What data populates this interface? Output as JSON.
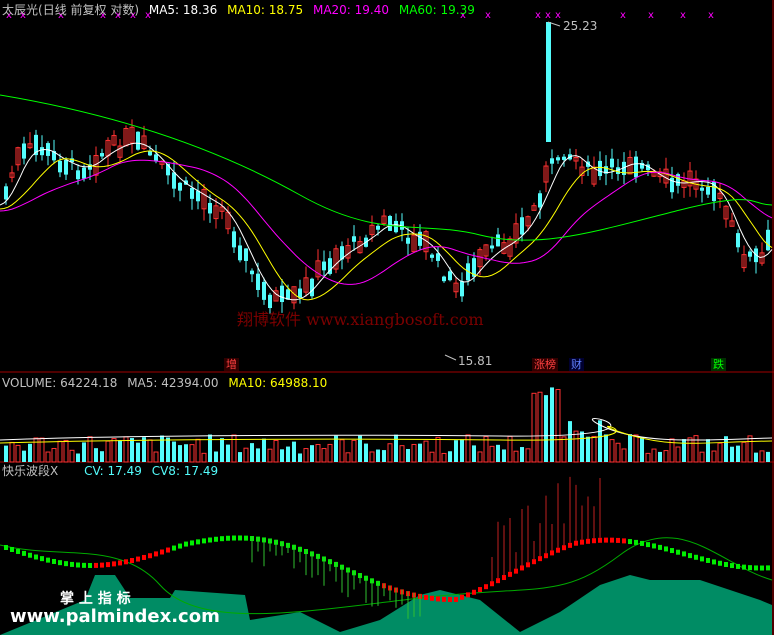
{
  "main_panel": {
    "stock_name": "太辰光",
    "period_label": "(日线 前复权 对数)",
    "ma5": "MA5: 18.36",
    "ma10": "MA10: 18.75",
    "ma20": "MA20: 19.40",
    "ma60": "MA60: 19.39",
    "high_label": "25.23",
    "low_label": "15.81",
    "markers": {
      "zeng": "增",
      "zhangbang": "涨榜",
      "cai": "财",
      "die": "跌"
    }
  },
  "volume_panel": {
    "volume": "VOLUME: 64224.18",
    "ma5": "MA5: 42394.00",
    "ma10": "MA10: 64988.10"
  },
  "indicator_panel": {
    "name": "快乐波段X",
    "cv": "CV: 17.49",
    "cv8": "CV8: 17.49"
  },
  "watermarks": {
    "center": "翔博软件 www.xiangbosoft.com",
    "bottom_title": "掌 上 指 标",
    "bottom_url": "www.palmindex.com"
  },
  "colors": {
    "up": "#ff3232",
    "down": "#54fcfc",
    "ma5": "#ffffff",
    "ma10": "#ffff00",
    "ma20": "#ff00ff",
    "ma60": "#00ff00",
    "grid": "#a00000",
    "wave_up": "#ff0000",
    "wave_down": "#00ee00",
    "band": "#008c64"
  }
}
